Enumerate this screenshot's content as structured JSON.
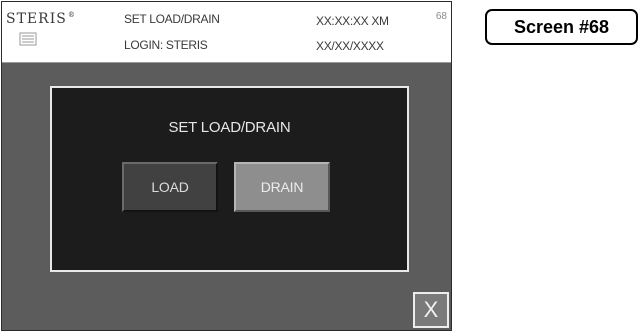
{
  "header": {
    "brand": "STERIS",
    "title": "SET LOAD/DRAIN",
    "login": "LOGIN: STERIS",
    "time": "XX:XX:XX XM",
    "date": "XX/XX/XXXX",
    "screen_number": "68"
  },
  "dialog": {
    "title": "SET LOAD/DRAIN",
    "load_label": "LOAD",
    "drain_label": "DRAIN"
  },
  "close_label": "X",
  "caption": "Screen #68",
  "colors": {
    "background": "#5c5c5c",
    "dialog": "#1c1c1c",
    "load_button": "#414141",
    "drain_button": "#8e8e8e"
  }
}
